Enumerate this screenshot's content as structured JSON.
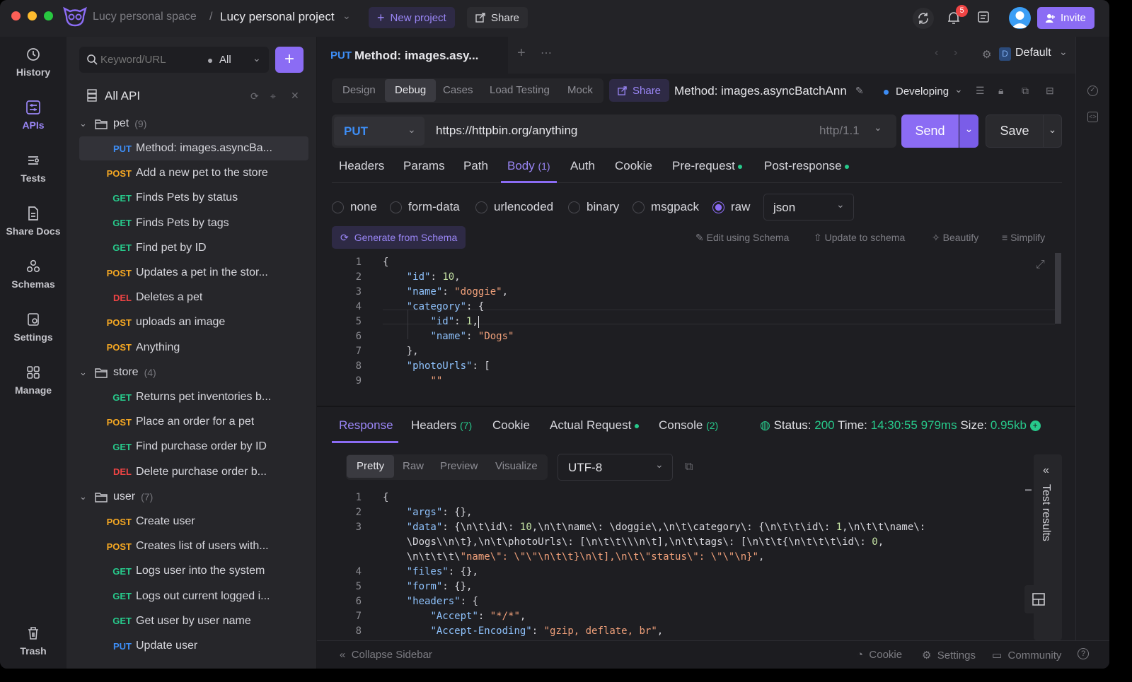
{
  "titlebar": {
    "space": "Lucy personal space",
    "separator": "/",
    "project": "Lucy personal project",
    "new_project": "New project",
    "share": "Share",
    "notif_count": "5",
    "invite": "Invite"
  },
  "rail": [
    {
      "label": "History",
      "icon": "history-icon"
    },
    {
      "label": "APIs",
      "icon": "apis-icon"
    },
    {
      "label": "Tests",
      "icon": "tests-icon"
    },
    {
      "label": "Share Docs",
      "icon": "share-docs-icon"
    },
    {
      "label": "Schemas",
      "icon": "schemas-icon"
    },
    {
      "label": "Settings",
      "icon": "settings-icon"
    },
    {
      "label": "Manage",
      "icon": "manage-icon"
    },
    {
      "label": "Trash",
      "icon": "trash-icon"
    }
  ],
  "sidebar": {
    "search_placeholder": "Keyword/URL",
    "filter": "All",
    "all_api": "All API",
    "folders": [
      {
        "name": "pet",
        "count": "(9)"
      },
      {
        "name": "store",
        "count": "(4)"
      },
      {
        "name": "user",
        "count": "(7)"
      }
    ],
    "pet": [
      {
        "method": "PUT",
        "name": "Method: images.asyncBa..."
      },
      {
        "method": "POST",
        "name": "Add a new pet to the store"
      },
      {
        "method": "GET",
        "name": "Finds Pets by status"
      },
      {
        "method": "GET",
        "name": "Finds Pets by tags"
      },
      {
        "method": "GET",
        "name": "Find pet by ID"
      },
      {
        "method": "POST",
        "name": "Updates a pet in the stor..."
      },
      {
        "method": "DEL",
        "name": "Deletes a pet"
      },
      {
        "method": "POST",
        "name": "uploads an image"
      },
      {
        "method": "POST",
        "name": "Anything"
      }
    ],
    "store": [
      {
        "method": "GET",
        "name": "Returns pet inventories b..."
      },
      {
        "method": "POST",
        "name": "Place an order for a pet"
      },
      {
        "method": "GET",
        "name": "Find purchase order by ID"
      },
      {
        "method": "DEL",
        "name": "Delete purchase order b..."
      }
    ],
    "user": [
      {
        "method": "POST",
        "name": "Create user"
      },
      {
        "method": "POST",
        "name": "Creates list of users with..."
      },
      {
        "method": "GET",
        "name": "Logs user into the system"
      },
      {
        "method": "GET",
        "name": "Logs out current logged i..."
      },
      {
        "method": "GET",
        "name": "Get user by user name"
      },
      {
        "method": "PUT",
        "name": "Update user"
      }
    ]
  },
  "tab": {
    "method": "PUT",
    "title": "Method: images.asy...",
    "env": "D",
    "env_name": "Default"
  },
  "subtabs": [
    "Design",
    "Debug",
    "Cases",
    "Load Testing",
    "Mock"
  ],
  "share": "Share",
  "endpoint_name": "Method: images.asyncBatchAnn",
  "status": "Developing",
  "request": {
    "method": "PUT",
    "url": "https://httpbin.org/anything",
    "protocol": "http/1.1",
    "send": "Send",
    "save": "Save"
  },
  "req_tabs": [
    {
      "label": "Headers"
    },
    {
      "label": "Params"
    },
    {
      "label": "Path"
    },
    {
      "label": "Body",
      "count": "(1)"
    },
    {
      "label": "Auth"
    },
    {
      "label": "Cookie"
    },
    {
      "label": "Pre-request"
    },
    {
      "label": "Post-response"
    }
  ],
  "body_types": [
    "none",
    "form-data",
    "urlencoded",
    "binary",
    "msgpack",
    "raw"
  ],
  "body_format": "json",
  "generate": "Generate from Schema",
  "body_tools": [
    "Edit using Schema",
    "Update to schema",
    "Beautify",
    "Simplify"
  ],
  "request_code": [
    [
      "1",
      "{"
    ],
    [
      "2",
      "    \"id\": 10,"
    ],
    [
      "3",
      "    \"name\": \"doggie\","
    ],
    [
      "4",
      "    \"category\": {"
    ],
    [
      "5",
      "        \"id\": 1,"
    ],
    [
      "6",
      "        \"name\": \"Dogs\""
    ],
    [
      "7",
      "    },"
    ],
    [
      "8",
      "    \"photoUrls\": ["
    ],
    [
      "9",
      "        \"\""
    ]
  ],
  "response": {
    "tabs": [
      {
        "label": "Response"
      },
      {
        "label": "Headers",
        "count": "(7)"
      },
      {
        "label": "Cookie"
      },
      {
        "label": "Actual Request"
      },
      {
        "label": "Console",
        "count": "(2)"
      }
    ],
    "status_label": "Status:",
    "status": "200",
    "time_label": "Time:",
    "time": "14:30:55",
    "duration": "979ms",
    "size_label": "Size:",
    "size": "0.95kb",
    "views": [
      "Pretty",
      "Raw",
      "Preview",
      "Visualize"
    ],
    "encoding": "UTF-8",
    "test_results": "Test results"
  },
  "response_code": [
    [
      "1",
      "{"
    ],
    [
      "2",
      "    \"args\": {},"
    ],
    [
      "3",
      "    \"data\": \"{\\n\\t\\\"id\\\": 10,\\n\\t\\\"name\\\": \\\"doggie\\\",\\n\\t\\\"category\\\": {\\n\\t\\t\\\"id\\\": 1,\\n\\t\\t\\\"name\\\":"
    ],
    [
      "",
      "    \\\"Dogs\\\"\\n\\t},\\n\\t\\\"photoUrls\\\": [\\n\\t\\t\\\"\\\"\\n\\t],\\n\\t\\\"tags\\\": [\\n\\t\\t{\\n\\t\\t\\t\\\"id\\\": 0,"
    ],
    [
      "",
      "    \\n\\t\\t\\t\\\"name\\\": \\\"\\\"\\n\\t\\t}\\n\\t],\\n\\t\\\"status\\\": \\\"\\\"\\n}\","
    ],
    [
      "4",
      "    \"files\": {},"
    ],
    [
      "5",
      "    \"form\": {},"
    ],
    [
      "6",
      "    \"headers\": {"
    ],
    [
      "7",
      "        \"Accept\": \"*/*\","
    ],
    [
      "8",
      "        \"Accept-Encoding\": \"gzip, deflate, br\","
    ]
  ],
  "footer": {
    "collapse": "Collapse Sidebar",
    "cookie": "Cookie",
    "settings": "Settings",
    "community": "Community"
  },
  "colors": {
    "accent": "#8b6cf4",
    "put": "#3d8df5",
    "post": "#f4a723",
    "get": "#27c98b",
    "del": "#ef4444",
    "ok": "#27c98b"
  }
}
